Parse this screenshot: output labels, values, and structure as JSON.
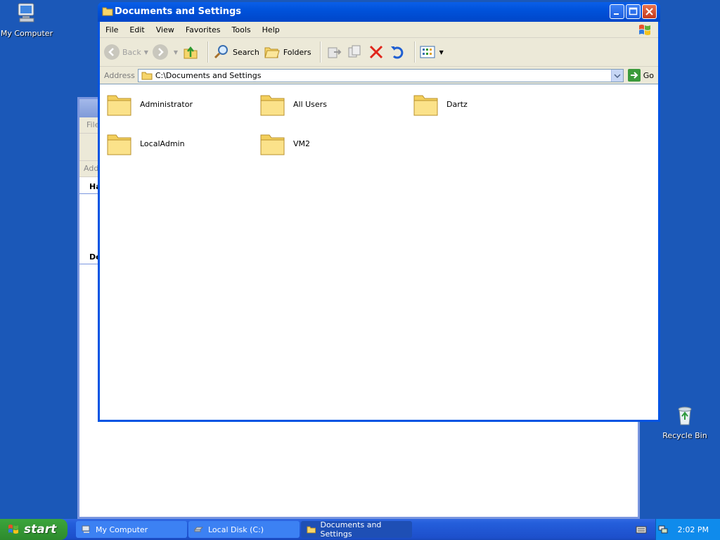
{
  "desktop": {
    "icons": [
      {
        "label": "My Computer",
        "icon": "my-computer-icon"
      },
      {
        "label": "Recycle Bin",
        "icon": "recycle-bin-icon"
      }
    ]
  },
  "background_window": {
    "menu_partial": "File",
    "addr_partial": "Addr",
    "sec1": "Ha",
    "sec2": "De"
  },
  "window": {
    "title": "Documents and Settings",
    "menu": [
      "File",
      "Edit",
      "View",
      "Favorites",
      "Tools",
      "Help"
    ],
    "toolbar": {
      "back_label": "Back",
      "search_label": "Search",
      "folders_label": "Folders"
    },
    "address": {
      "label": "Address",
      "value": "C:\\Documents and Settings",
      "go_label": "Go"
    },
    "folders": [
      "Administrator",
      "All Users",
      "Dartz",
      "LocalAdmin",
      "VM2"
    ]
  },
  "taskbar": {
    "start_label": "start",
    "tasks": [
      {
        "label": "My Computer",
        "active": false
      },
      {
        "label": "Local Disk (C:)",
        "active": false
      },
      {
        "label": "Documents and Settings",
        "active": true
      }
    ],
    "clock": "2:02 PM"
  },
  "colors": {
    "desktop": "#1b58b8",
    "titlebar": "#0054e3",
    "start": "#3ca53c"
  }
}
